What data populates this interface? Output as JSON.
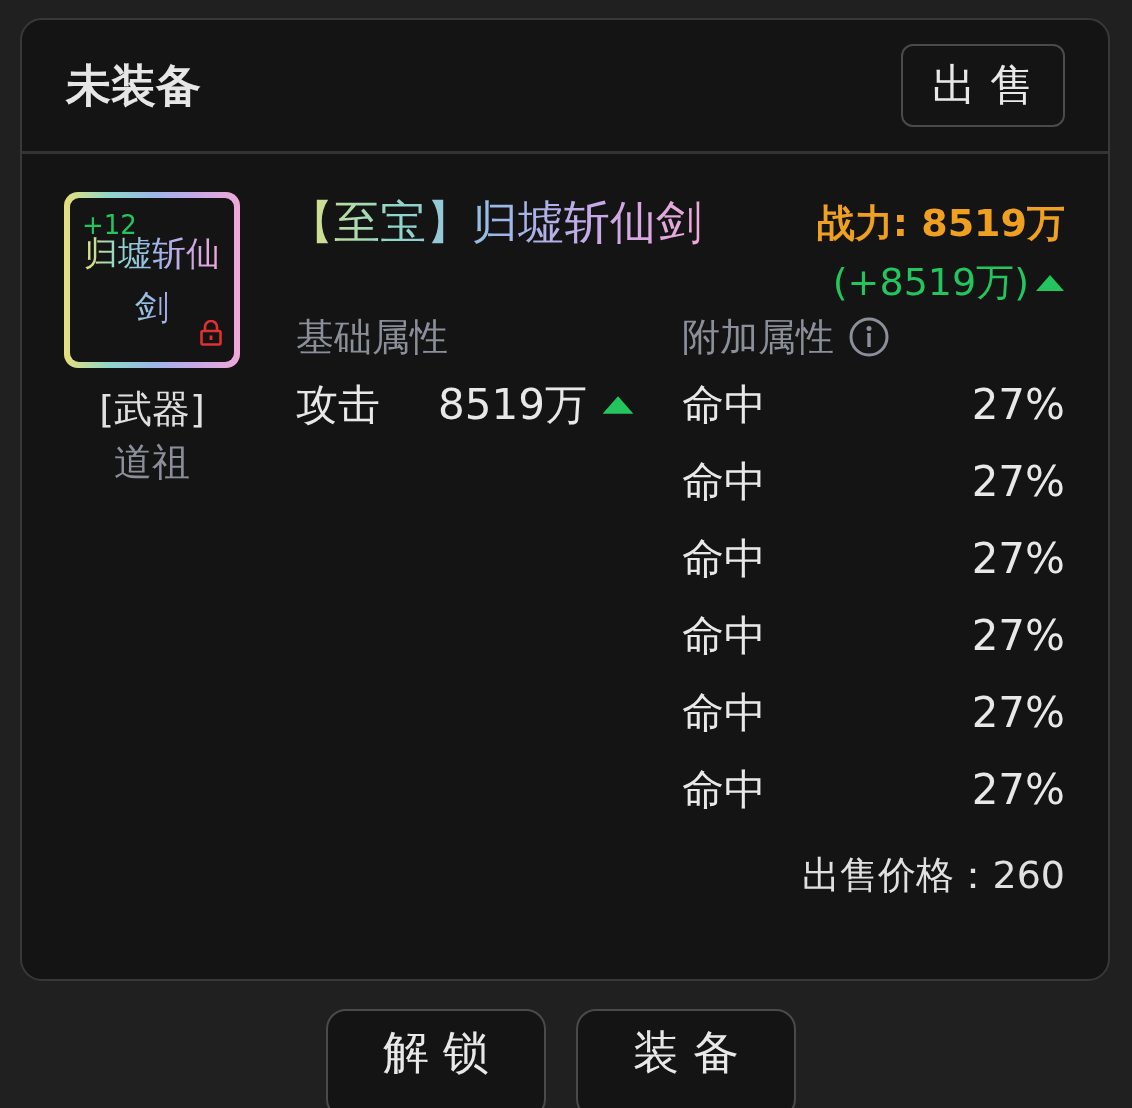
{
  "header": {
    "title": "未装备",
    "sell_button": "出 售"
  },
  "item": {
    "icon_text": "归墟斩仙剑",
    "enhance": "+12",
    "locked": true,
    "type": "[武器]",
    "owner": "道祖",
    "name": "【至宝】归墟斩仙剑",
    "power": "战力: 8519万",
    "power_change": "(+8519万)",
    "power_up": true
  },
  "base": {
    "heading": "基础属性",
    "stats": [
      {
        "name": "攻击",
        "value": "8519万",
        "up": true
      }
    ]
  },
  "extra": {
    "heading": "附加属性",
    "stats": [
      {
        "name": "命中",
        "value": "27%"
      },
      {
        "name": "命中",
        "value": "27%"
      },
      {
        "name": "命中",
        "value": "27%"
      },
      {
        "name": "命中",
        "value": "27%"
      },
      {
        "name": "命中",
        "value": "27%"
      },
      {
        "name": "命中",
        "value": "27%"
      }
    ]
  },
  "sell_price": "出售价格：260",
  "buttons": [
    "解 锁",
    "装 备"
  ]
}
